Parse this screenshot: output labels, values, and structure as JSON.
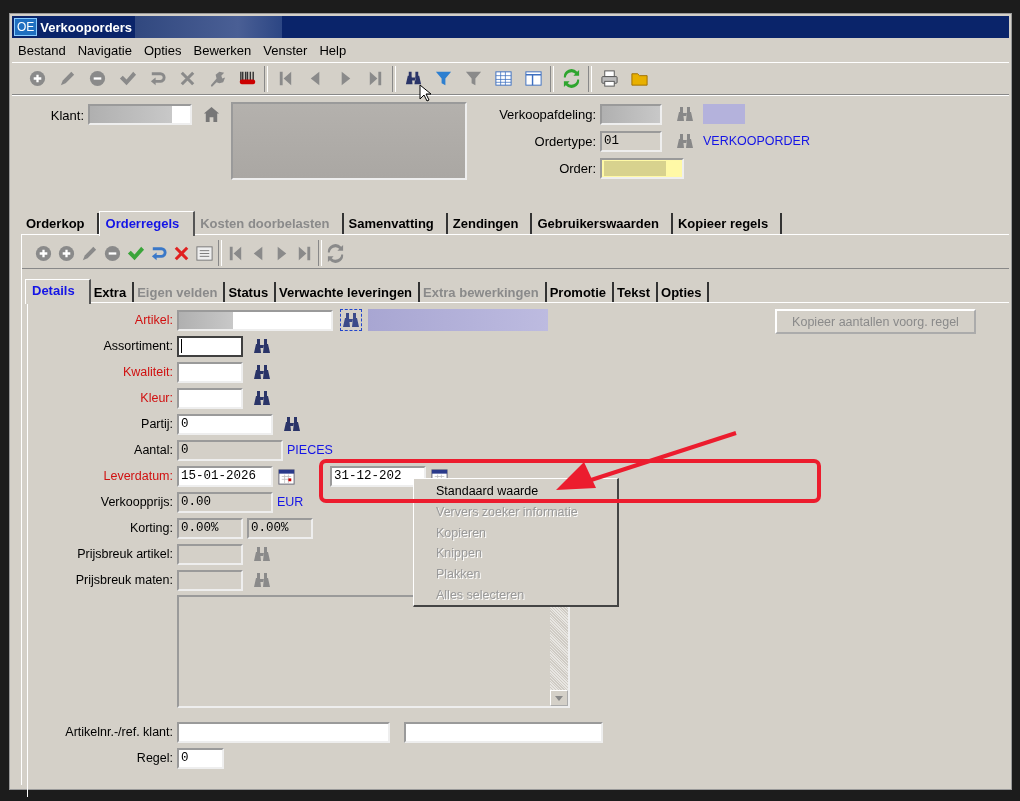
{
  "window": {
    "badge": "OE",
    "title": "Verkooporders"
  },
  "menu": [
    "Bestand",
    "Navigatie",
    "Opties",
    "Bewerken",
    "Venster",
    "Help"
  ],
  "header": {
    "klant_label": "Klant:",
    "verkoopafdeling_label": "Verkoopafdeling:",
    "ordertype_label": "Ordertype:",
    "ordertype_value": "01",
    "ordertype_description": "VERKOOPORDER",
    "order_label": "Order:"
  },
  "tabs": [
    {
      "label": "Orderkop",
      "selected": false,
      "disabled": false
    },
    {
      "label": "Orderregels",
      "selected": true,
      "disabled": false
    },
    {
      "label": "Kosten doorbelasten",
      "selected": false,
      "disabled": true
    },
    {
      "label": "Samenvatting",
      "selected": false,
      "disabled": false
    },
    {
      "label": "Zendingen",
      "selected": false,
      "disabled": false
    },
    {
      "label": "Gebruikerswaarden",
      "selected": false,
      "disabled": false
    },
    {
      "label": "Kopieer regels",
      "selected": false,
      "disabled": false
    }
  ],
  "subtabs": [
    {
      "label": "Details",
      "selected": true,
      "disabled": false
    },
    {
      "label": "Extra",
      "selected": false,
      "disabled": false
    },
    {
      "label": "Eigen velden",
      "selected": false,
      "disabled": true
    },
    {
      "label": "Status",
      "selected": false,
      "disabled": false
    },
    {
      "label": "Verwachte leveringen",
      "selected": false,
      "disabled": false
    },
    {
      "label": "Extra bewerkingen",
      "selected": false,
      "disabled": true
    },
    {
      "label": "Promotie",
      "selected": false,
      "disabled": false
    },
    {
      "label": "Tekst",
      "selected": false,
      "disabled": false
    },
    {
      "label": "Opties",
      "selected": false,
      "disabled": false
    }
  ],
  "form": [
    {
      "kind": "article",
      "label": "Artikel:",
      "required": true
    },
    {
      "kind": "lookup",
      "label": "Assortiment:",
      "required": false,
      "focused": true
    },
    {
      "kind": "lookup",
      "label": "Kwaliteit:",
      "required": true,
      "focused": false
    },
    {
      "kind": "lookup",
      "label": "Kleur:",
      "required": true,
      "focused": false
    },
    {
      "kind": "batch",
      "label": "Partij:",
      "required": false,
      "value": "0"
    },
    {
      "kind": "quantity",
      "label": "Aantal:",
      "required": false,
      "value": "0",
      "unit": "PIECES"
    },
    {
      "kind": "date",
      "label": "Leverdatum:",
      "required": true,
      "value": "15-01-2026",
      "second_value": "31-12-202"
    },
    {
      "kind": "price",
      "label": "Verkoopprijs:",
      "required": false,
      "value": "0.00",
      "unit": "EUR"
    },
    {
      "kind": "discount",
      "label": "Korting:",
      "required": false,
      "values": [
        "0.00%",
        "0.00%"
      ]
    },
    {
      "kind": "pricebreak",
      "label": "Prijsbreuk artikel:",
      "required": false
    },
    {
      "kind": "pricebreak",
      "label": "Prijsbreuk maten:",
      "required": false
    },
    {
      "kind": "memo"
    },
    {
      "kind": "reference",
      "label": "Artikelnr.-/ref. klant:",
      "required": false
    },
    {
      "kind": "line",
      "label": "Regel:",
      "required": false,
      "value": "0"
    }
  ],
  "copy_button": {
    "label": "Kopieer aantallen voorg. regel",
    "disabled": true
  },
  "context_menu": [
    {
      "label": "Standaard waarde",
      "disabled": false
    },
    {
      "label": "Ververs zoeker informatie",
      "disabled": true
    },
    {
      "label": "Kopieren",
      "disabled": true
    },
    {
      "label": "Knippen",
      "disabled": true
    },
    {
      "label": "Plakken",
      "disabled": true
    },
    {
      "label": "Alles selecteren",
      "disabled": true
    }
  ]
}
